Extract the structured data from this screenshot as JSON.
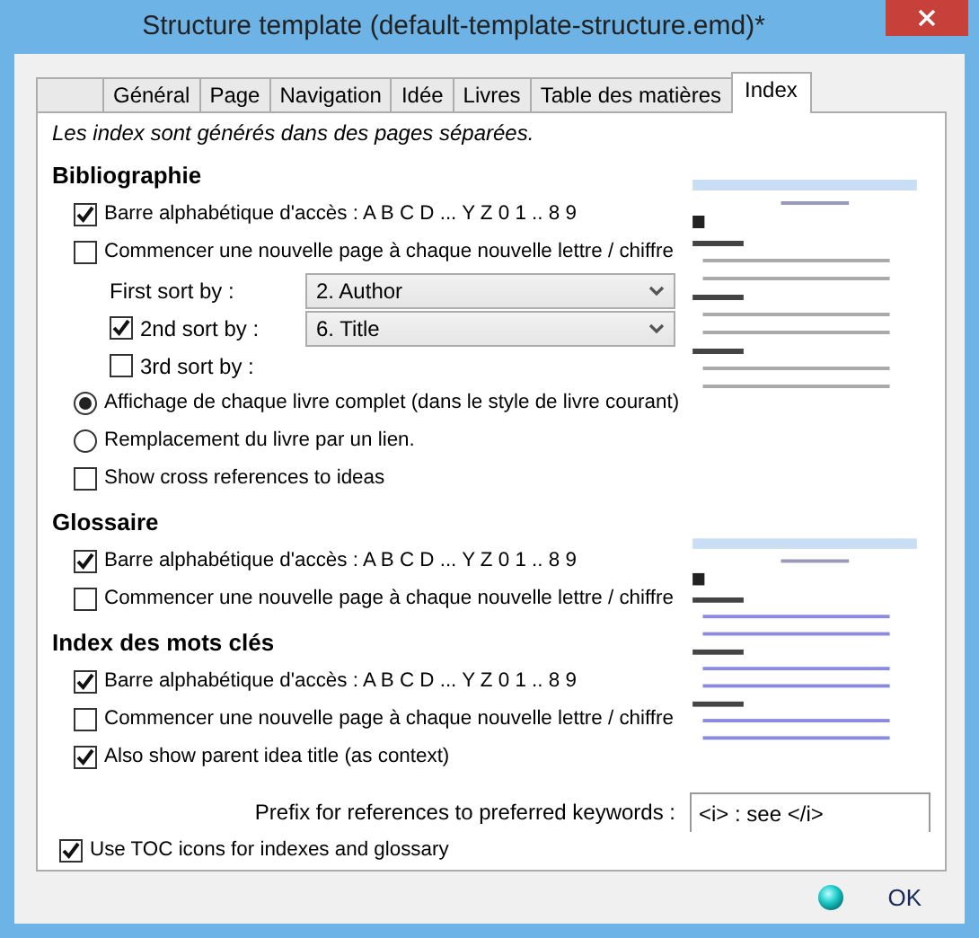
{
  "window": {
    "title": "Structure template (default-template-structure.emd)*"
  },
  "tabs": [
    {
      "selected": false
    },
    {
      "label": "Général",
      "selected": false
    },
    {
      "label": "Page",
      "selected": false
    },
    {
      "label": "Navigation",
      "selected": false
    },
    {
      "label": "Idée",
      "selected": false
    },
    {
      "label": "Livres",
      "selected": false
    },
    {
      "label": "Table des matières",
      "selected": false
    },
    {
      "label": "Index",
      "selected": true
    }
  ],
  "note": "Les index sont générés dans des pages séparées.",
  "sections": [
    {
      "heading": "Bibliographie",
      "items": [
        {
          "kind": "checkbox",
          "label": "Barre alphabétique d'accès : A B C D ... Y Z 0 1 .. 8 9",
          "checked": true
        },
        {
          "kind": "checkbox",
          "label": "Commencer une nouvelle page à chaque nouvelle lettre / chiffre",
          "checked": false
        },
        {
          "kind": "sort",
          "label": "First sort by :",
          "value": "2. Author"
        },
        {
          "kind": "checksort",
          "label": "2nd sort by :",
          "checked": true,
          "value": "6. Title"
        },
        {
          "kind": "checksort",
          "label": "3rd sort by :",
          "checked": false
        },
        {
          "kind": "radio",
          "label": "Affichage de chaque livre complet (dans le style de livre courant)",
          "selected": true
        },
        {
          "kind": "radio",
          "label": "Remplacement du livre par un lien.",
          "selected": false
        },
        {
          "kind": "checkbox",
          "label": "Show cross references to ideas",
          "checked": false
        }
      ]
    },
    {
      "heading": "Glossaire",
      "items": [
        {
          "kind": "checkbox",
          "label": "Barre alphabétique d'accès : A B C D ... Y Z 0 1 .. 8 9",
          "checked": true
        },
        {
          "kind": "checkbox",
          "label": "Commencer une nouvelle page à chaque nouvelle lettre / chiffre",
          "checked": false
        }
      ]
    },
    {
      "heading": "Index des mots clés",
      "items": [
        {
          "kind": "checkbox",
          "label": "Barre alphabétique d'accès : A B C D ... Y Z 0 1 .. 8 9",
          "checked": true
        },
        {
          "kind": "checkbox",
          "label": "Commencer une nouvelle page à chaque nouvelle lettre / chiffre",
          "checked": false
        },
        {
          "kind": "checkbox",
          "label": "Also show parent idea title (as context)",
          "checked": true
        }
      ]
    }
  ],
  "prefix": {
    "label": "Prefix for references to preferred keywords :",
    "value": "<i> : see </i>"
  },
  "toc_icons": {
    "label": "Use TOC icons for indexes and glossary",
    "checked": true
  },
  "ok_button": {
    "label": "OK"
  }
}
